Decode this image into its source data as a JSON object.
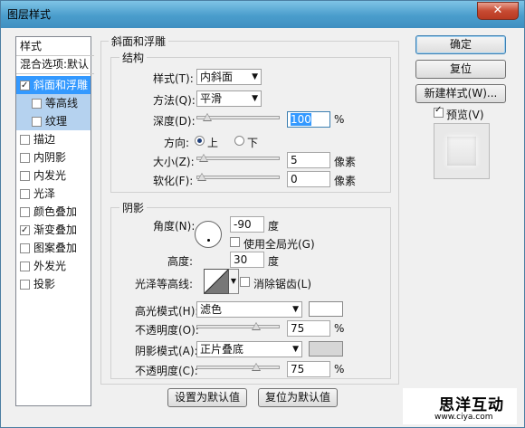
{
  "window": {
    "title": "图层样式",
    "close_glyph": "✕"
  },
  "sidebar": {
    "header": "样式",
    "blend_options": "混合选项:默认",
    "items": [
      {
        "label": "斜面和浮雕",
        "checked": true
      },
      {
        "label": "等高线",
        "checked": false
      },
      {
        "label": "纹理",
        "checked": false
      },
      {
        "label": "描边",
        "checked": false
      },
      {
        "label": "内阴影",
        "checked": false
      },
      {
        "label": "内发光",
        "checked": false
      },
      {
        "label": "光泽",
        "checked": false
      },
      {
        "label": "颜色叠加",
        "checked": false
      },
      {
        "label": "渐变叠加",
        "checked": true
      },
      {
        "label": "图案叠加",
        "checked": false
      },
      {
        "label": "外发光",
        "checked": false
      },
      {
        "label": "投影",
        "checked": false
      }
    ]
  },
  "bevel": {
    "section_title": "斜面和浮雕",
    "structure_title": "结构",
    "style_label": "样式(T):",
    "style_value": "内斜面",
    "technique_label": "方法(Q):",
    "technique_value": "平滑",
    "depth_label": "深度(D):",
    "depth_value": "100",
    "depth_unit": "%",
    "depth_slider": 0.08,
    "direction_label": "方向:",
    "direction_up": "上",
    "direction_down": "下",
    "size_label": "大小(Z):",
    "size_value": "5",
    "size_unit": "像素",
    "size_slider": 0.02,
    "soften_label": "软化(F):",
    "soften_value": "0",
    "soften_unit": "像素",
    "soften_slider": 0.0
  },
  "shading": {
    "title": "阴影",
    "angle_label": "角度(N):",
    "angle_value": "-90",
    "angle_unit": "度",
    "global_light_label": "使用全局光(G)",
    "altitude_label": "高度:",
    "altitude_value": "30",
    "altitude_unit": "度",
    "gloss_label": "光泽等高线:",
    "antialias_label": "消除锯齿(L)",
    "highlight_mode_label": "高光模式(H):",
    "highlight_mode_value": "滤色",
    "highlight_color": "#ffffff",
    "highlight_opacity_label": "不透明度(O):",
    "highlight_opacity_value": "75",
    "highlight_opacity_unit": "%",
    "highlight_opacity_slider": 0.75,
    "shadow_mode_label": "阴影模式(A):",
    "shadow_mode_value": "正片叠底",
    "shadow_color": "#d6d6d6",
    "shadow_opacity_label": "不透明度(C):",
    "shadow_opacity_value": "75",
    "shadow_opacity_unit": "%",
    "shadow_opacity_slider": 0.75
  },
  "footer": {
    "make_default": "设置为默认值",
    "reset_default": "复位为默认值"
  },
  "buttons": {
    "ok": "确定",
    "reset": "复位",
    "new_style": "新建样式(W)...",
    "preview_label": "预览(V)"
  },
  "watermark": {
    "text": "思洋互动",
    "url": "www.ciya.com"
  }
}
